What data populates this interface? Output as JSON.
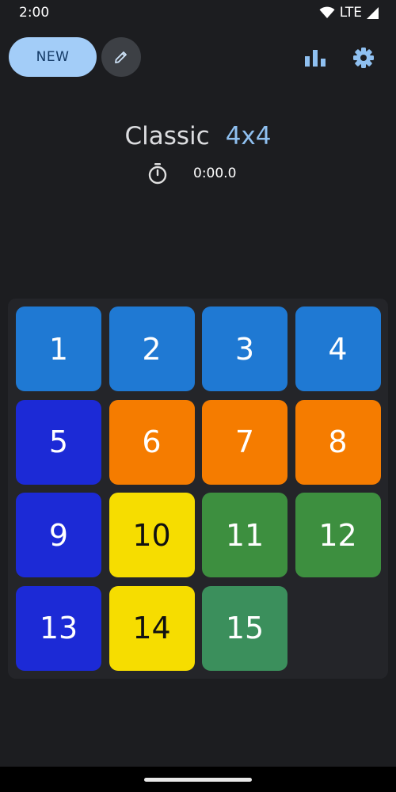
{
  "status_bar": {
    "time": "2:00",
    "network": "LTE"
  },
  "toolbar": {
    "new_label": "NEW",
    "edit_icon": "pencil-icon",
    "stats_icon": "bar-chart-icon",
    "settings_icon": "gear-icon",
    "accent": "#8fc0f0"
  },
  "header": {
    "mode": "Classic",
    "size": "4x4",
    "timer_icon": "stopwatch-icon",
    "timer": "0:00.0"
  },
  "board": {
    "rows": 4,
    "cols": 4,
    "tiles": [
      {
        "label": "1",
        "color": "#1f79d3",
        "text_color": "#ffffff"
      },
      {
        "label": "2",
        "color": "#1f79d3",
        "text_color": "#ffffff"
      },
      {
        "label": "3",
        "color": "#1f79d3",
        "text_color": "#ffffff"
      },
      {
        "label": "4",
        "color": "#1f79d3",
        "text_color": "#ffffff"
      },
      {
        "label": "5",
        "color": "#1c2ad6",
        "text_color": "#ffffff"
      },
      {
        "label": "6",
        "color": "#f57c00",
        "text_color": "#ffffff"
      },
      {
        "label": "7",
        "color": "#f57c00",
        "text_color": "#ffffff"
      },
      {
        "label": "8",
        "color": "#f57c00",
        "text_color": "#ffffff"
      },
      {
        "label": "9",
        "color": "#1c2ad6",
        "text_color": "#ffffff"
      },
      {
        "label": "10",
        "color": "#f6dd00",
        "text_color": "#111111"
      },
      {
        "label": "11",
        "color": "#3d8f3f",
        "text_color": "#ffffff"
      },
      {
        "label": "12",
        "color": "#3d8f3f",
        "text_color": "#ffffff"
      },
      {
        "label": "13",
        "color": "#1c2ad6",
        "text_color": "#ffffff"
      },
      {
        "label": "14",
        "color": "#f6dd00",
        "text_color": "#111111"
      },
      {
        "label": "15",
        "color": "#3b8f5c",
        "text_color": "#ffffff"
      },
      null
    ]
  }
}
